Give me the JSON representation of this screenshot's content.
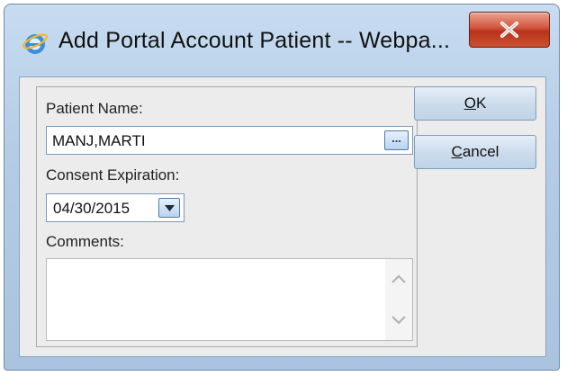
{
  "window": {
    "title": "Add Portal Account Patient -- Webpa..."
  },
  "form": {
    "patient_name_label": "Patient Name:",
    "patient_name_value": "MANJ,MARTI",
    "lookup_button_label": "...",
    "consent_expiration_label": "Consent Expiration:",
    "consent_expiration_value": "04/30/2015",
    "comments_label": "Comments:",
    "comments_value": ""
  },
  "buttons": {
    "ok": {
      "mnemonic": "O",
      "rest": "K"
    },
    "cancel": {
      "mnemonic": "C",
      "rest": "ancel"
    }
  },
  "icons": {
    "app": "internet-explorer-icon",
    "close": "close-icon",
    "dropdown": "chevron-down-icon",
    "scroll_up": "chevron-up-icon",
    "scroll_down": "chevron-down-icon"
  },
  "colors": {
    "close_button": "#c9452c",
    "title_bar": "#b4cce6",
    "button_face": "#cddcec"
  }
}
